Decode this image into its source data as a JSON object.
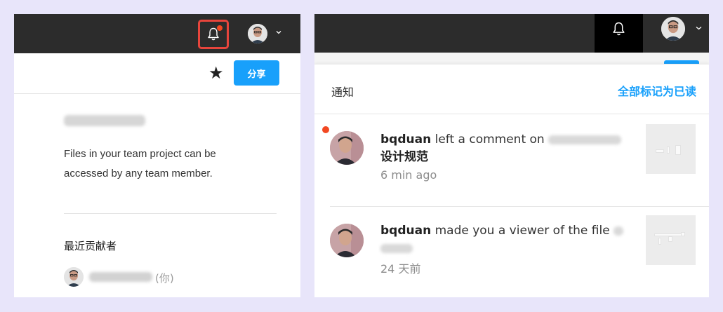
{
  "left": {
    "share_label": "分享",
    "star_glyph": "★",
    "description": "Files in your team project can be accessed by any team member.",
    "contributors_title": "最近贡献者",
    "contributor_you": "(你)"
  },
  "right": {
    "header_title": "通知",
    "mark_all_read": "全部标记为已读",
    "notifications": [
      {
        "user": "bqduan",
        "action": " left a comment on ",
        "file_suffix": "设计规范",
        "time": "6 min ago",
        "unread": true
      },
      {
        "user": "bqduan",
        "action": " made you a viewer of the file ",
        "time": "24 天前",
        "unread": false
      }
    ]
  },
  "colors": {
    "accent": "#18a0fb",
    "unread": "#f24822",
    "highlight_border": "#e8453c",
    "topbar": "#2c2c2c"
  },
  "icons": [
    "bell-icon",
    "avatar",
    "chevron-down-icon",
    "star-icon"
  ]
}
